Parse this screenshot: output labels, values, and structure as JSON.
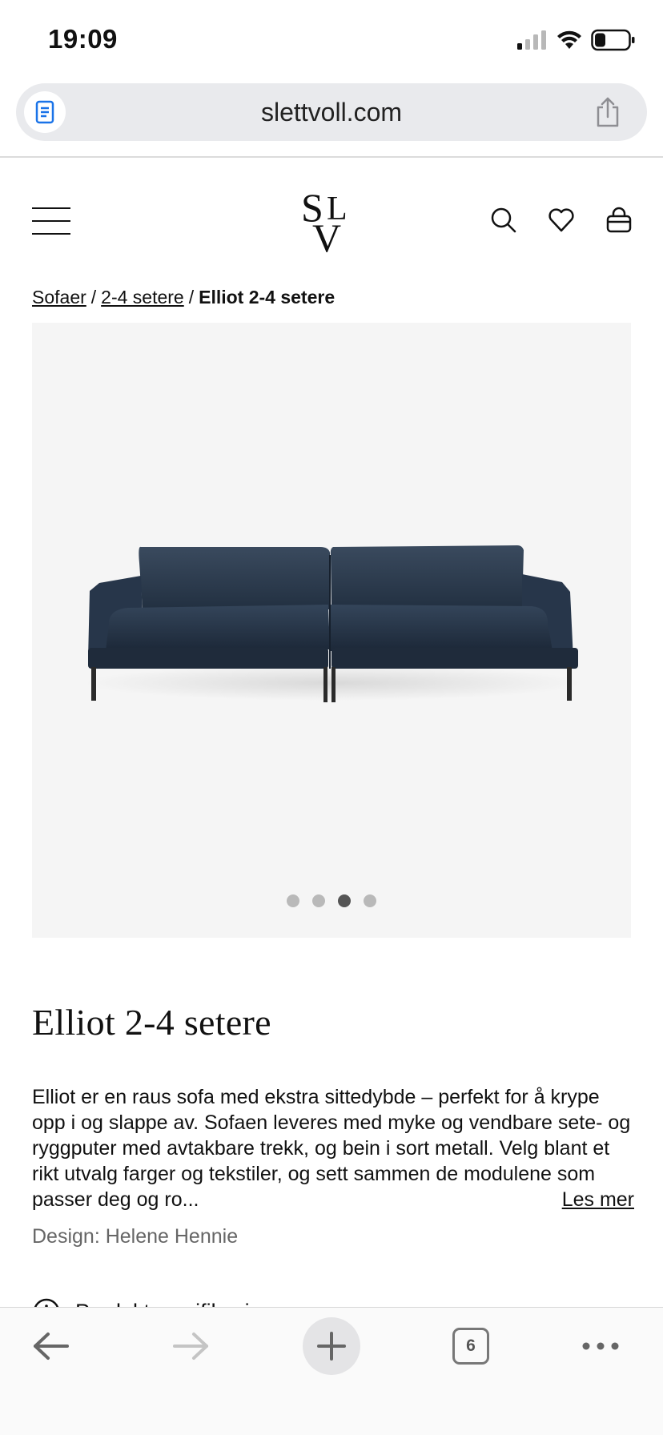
{
  "status_bar": {
    "time": "19:09"
  },
  "browser": {
    "url": "slettvoll.com",
    "tab_count": "6"
  },
  "header": {
    "logo_text": "SLV"
  },
  "breadcrumb": {
    "items": [
      "Sofaer",
      "2-4 setere"
    ],
    "separator": "/",
    "current": "Elliot 2-4 setere"
  },
  "gallery": {
    "image_alt": "Elliot 2-4 setere sofa",
    "slide_count": 4,
    "active_slide": 3,
    "sofa_color": "#2b3a4d"
  },
  "product": {
    "title": "Elliot 2-4 setere",
    "description": "Elliot er en raus sofa med ekstra sittedybde – perfekt for å krype opp i og slappe av. Sofaen leveres med myke og vendbare sete- og ryggputer med avtakbare trekk, og bein i sort metall. Velg blant et rikt utvalg farger og tekstiler, og sett sammen de modulene som passer deg og ro...",
    "read_more": "Les mer",
    "designer": "Design: Helene Hennie",
    "spec_label": "Produktspesifikasjoner"
  },
  "icons": {
    "reader": "reader-icon",
    "share": "share-icon",
    "menu": "menu-icon",
    "search": "search-icon",
    "wishlist": "heart-icon",
    "cart": "bag-icon",
    "info": "info-icon",
    "back": "back-arrow-icon",
    "forward": "forward-arrow-icon",
    "new_tab": "plus-icon",
    "more": "more-icon"
  }
}
